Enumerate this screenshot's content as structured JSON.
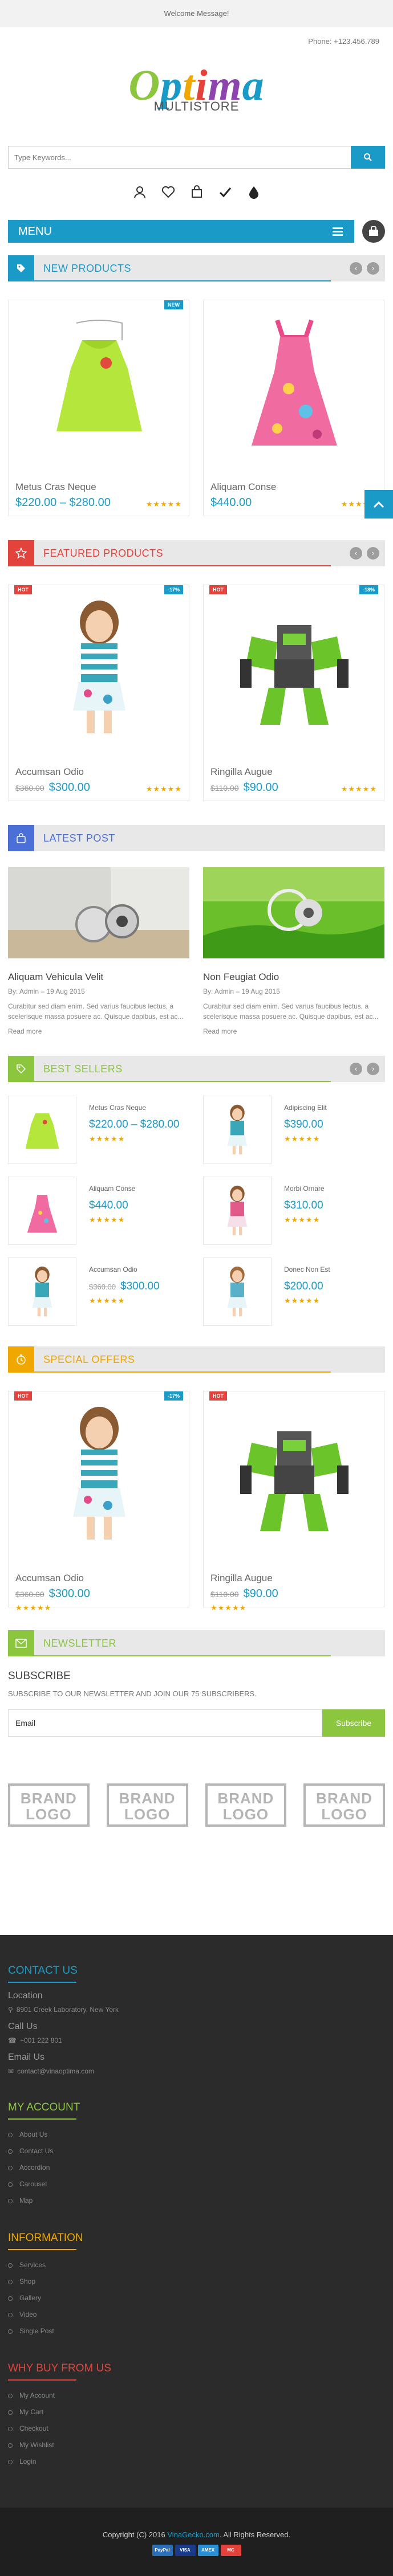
{
  "topbar": {
    "welcome": "Welcome Message!"
  },
  "header": {
    "phone": "Phone: +123.456.789",
    "logo_letters": [
      "O",
      "p",
      "t",
      "i",
      "m",
      "a"
    ],
    "logo_colors": [
      "#8cc63f",
      "#1a9bc7",
      "#f0a800",
      "#e2433c",
      "#8e44ad",
      "#1a9bc7"
    ],
    "logo_sub": "MULTISTORE"
  },
  "search": {
    "placeholder": "Type Keywords..."
  },
  "toolbar_icons": [
    "user-icon",
    "heart-icon",
    "cart-icon",
    "check-icon",
    "water-drop-icon"
  ],
  "menu": {
    "label": "MENU"
  },
  "sections": {
    "new_products": {
      "title": "NEW PRODUCTS",
      "color": "#1a9bc7"
    },
    "featured_products": {
      "title": "FEATURED PRODUCTS",
      "color": "#e2433c"
    },
    "latest_post": {
      "title": "LATEST POST",
      "color": "#4a6fd6"
    },
    "best_sellers": {
      "title": "BEST SELLERS",
      "color": "#8cc63f"
    },
    "special_offers": {
      "title": "SPECIAL OFFERS",
      "color": "#f0a800"
    },
    "newsletter": {
      "title": "NEWSLETTER",
      "color": "#8cc63f"
    }
  },
  "new_products": [
    {
      "badge": "NEW",
      "name": "Metus Cras Neque",
      "price": "$220.00 – $280.00",
      "old_price": "",
      "stars": "★★★★★",
      "image": "green-dress"
    },
    {
      "badge": "",
      "name": "Aliquam Conse",
      "price": "$440.00",
      "old_price": "",
      "stars": "★★★★★",
      "image": "pink-dress"
    }
  ],
  "featured_products": [
    {
      "badge_left": "HOT",
      "badge_right": "-17%",
      "name": "Accumsan Odio",
      "price": "$300.00",
      "old_price": "$360.00",
      "stars": "★★★★★",
      "image": "girl"
    },
    {
      "badge_left": "HOT",
      "badge_right": "-18%",
      "name": "Ringilla Augue",
      "price": "$90.00",
      "old_price": "$110.00",
      "stars": "★★★★★",
      "image": "robot"
    }
  ],
  "posts": [
    {
      "title": "Aliquam Vehicula Velit",
      "meta": "By: Admin – 19 Aug 2015",
      "excerpt": "Curabitur sed diam enim. Sed varius faucibus lectus, a scelerisque massa posuere ac. Quisque dapibus, est ac...",
      "more": "Read more",
      "image": "headphones-desk"
    },
    {
      "title": "Non Feugiat Odio",
      "meta": "By: Admin – 19 Aug 2015",
      "excerpt": "Curabitur sed diam enim. Sed varius faucibus lectus, a scelerisque massa posuere ac. Quisque dapibus, est ac...",
      "more": "Read more",
      "image": "headphones-grass"
    }
  ],
  "best_sellers": [
    {
      "name": "Metus Cras Neque",
      "price": "$220.00 – $280.00",
      "old_price": "",
      "stars": "★★★★★",
      "image": "green-dress"
    },
    {
      "name": "Adipiscing Elit",
      "price": "$390.00",
      "old_price": "",
      "stars": "★★★★★",
      "image": "girl"
    },
    {
      "name": "Aliquam Conse",
      "price": "$440.00",
      "old_price": "",
      "stars": "★★★★★",
      "image": "pink-dress"
    },
    {
      "name": "Morbi Ornare",
      "price": "$310.00",
      "old_price": "",
      "stars": "★★★★★",
      "image": "girl"
    },
    {
      "name": "Accumsan Odio",
      "price": "$300.00",
      "old_price": "$360.00",
      "stars": "★★★★★",
      "image": "girl"
    },
    {
      "name": "Donec Non Est",
      "price": "$200.00",
      "old_price": "",
      "stars": "★★★★★",
      "image": "girl"
    }
  ],
  "special_offers": [
    {
      "badge_left": "HOT",
      "badge_right": "-17%",
      "name": "Accumsan Odio",
      "price": "$300.00",
      "old_price": "$360.00",
      "stars": "★★★★★",
      "image": "girl"
    },
    {
      "badge_left": "HOT",
      "badge_right": "",
      "name": "Ringilla Augue",
      "price": "$90.00",
      "old_price": "$110.00",
      "stars": "★★★★★",
      "image": "robot"
    }
  ],
  "newsletter": {
    "heading": "SUBSCRIBE",
    "text": "SUBSCRIBE TO OUR NEWSLETTER AND JOIN OUR 75 SUBSCRIBERS.",
    "input_value": "Email",
    "button": "Subscribe"
  },
  "brands": [
    "BRAND LOGO",
    "BRAND LOGO",
    "BRAND LOGO",
    "BRAND LOGO"
  ],
  "footer": {
    "contact": {
      "title": "CONTACT US",
      "color": "#1a9bc7",
      "location_label": "Location",
      "location": "8901 Creek Laboratory, New York",
      "call_label": "Call Us",
      "call": "+001 222 801",
      "email_label": "Email Us",
      "email": "contact@vinaoptima.com"
    },
    "account": {
      "title": "MY ACCOUNT",
      "color": "#8cc63f",
      "items": [
        "About Us",
        "Contact Us",
        "Accordion",
        "Carousel",
        "Map"
      ]
    },
    "information": {
      "title": "INFORMATION",
      "color": "#f0a800",
      "items": [
        "Services",
        "Shop",
        "Gallery",
        "Video",
        "Single Post"
      ]
    },
    "why_buy": {
      "title": "WHY BUY FROM US",
      "color": "#e2433c",
      "items": [
        "My Account",
        "My Cart",
        "Checkout",
        "My Wishlist",
        "Login"
      ]
    }
  },
  "copyright": {
    "prefix": "Copyright (C) 2016 ",
    "link": "VinaGecko.com",
    "suffix": ". All Rights Reserved."
  },
  "payments": [
    {
      "label": "PayPal",
      "color": "#2a6fb7"
    },
    {
      "label": "VISA",
      "color": "#1a3a8a"
    },
    {
      "label": "AMEX",
      "color": "#2b8fd6"
    },
    {
      "label": "MC",
      "color": "#e2433c"
    }
  ]
}
